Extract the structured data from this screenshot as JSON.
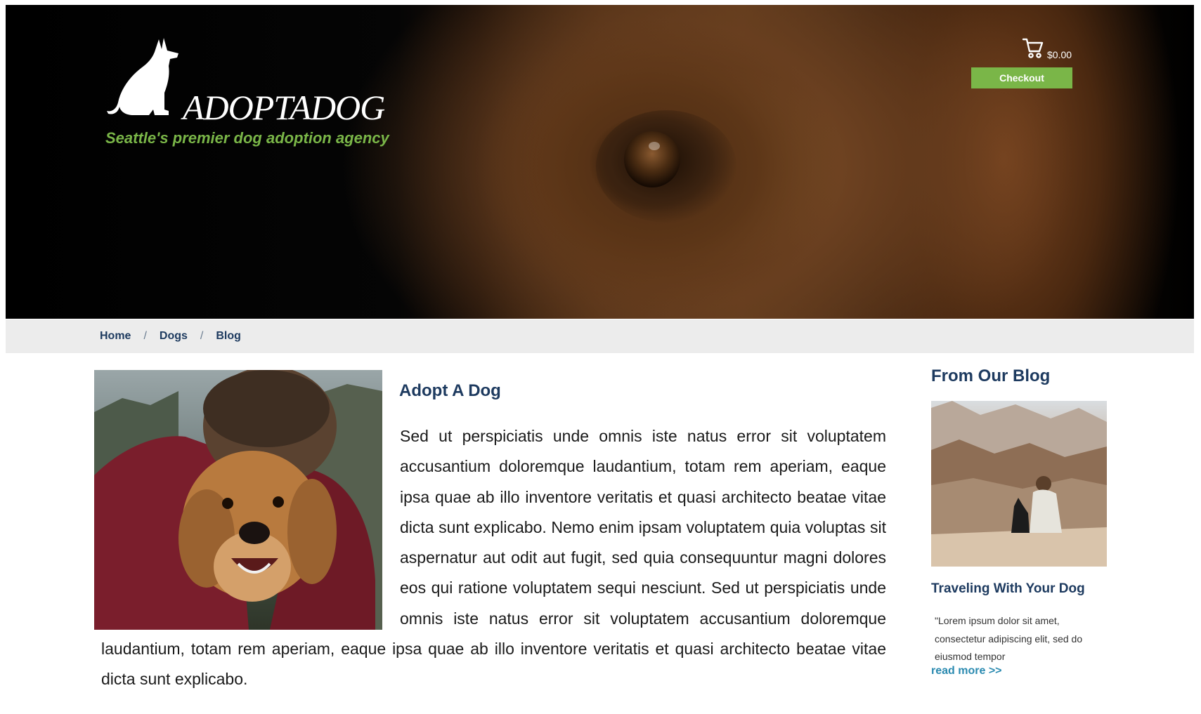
{
  "header": {
    "logo_text": "ADOPTADOG",
    "tagline": "Seattle's premier dog adoption agency",
    "cart_total": "$0.00",
    "checkout_label": "Checkout"
  },
  "breadcrumb": {
    "items": [
      {
        "label": "Home"
      },
      {
        "label": "Dogs"
      },
      {
        "label": "Blog"
      }
    ],
    "separator": "/"
  },
  "article": {
    "title": "Adopt A Dog",
    "body": "Sed ut perspiciatis unde omnis iste natus error sit voluptatem accusantium doloremque laudantium, totam rem aperiam, eaque ipsa quae ab illo inventore veritatis et quasi architecto beatae vitae dicta sunt explicabo. Nemo enim ipsam voluptatem quia voluptas sit aspernatur aut odit aut fugit, sed quia consequuntur magni dolores eos qui ratione voluptatem sequi nesciunt. Sed ut perspiciatis unde omnis iste natus error sit voluptatem accusantium doloremque laudantium, totam rem aperiam, eaque ipsa quae ab illo inventore veritatis et quasi architecto beatae vitae dicta sunt explicabo."
  },
  "sidebar": {
    "heading": "From Our Blog",
    "post": {
      "title": "Traveling With Your Dog",
      "excerpt": "\"Lorem ipsum dolor sit amet, consectetur adipiscing elit, sed do eiusmod tempor",
      "read_more": "read more >>"
    }
  },
  "colors": {
    "brand_green": "#7ab648",
    "navy": "#1d3a5f",
    "link_blue": "#2a8ab0",
    "breadcrumb_bg": "#ececec"
  },
  "icons": {
    "logo": "sitting-dog-silhouette",
    "cart": "shopping-cart-icon"
  }
}
